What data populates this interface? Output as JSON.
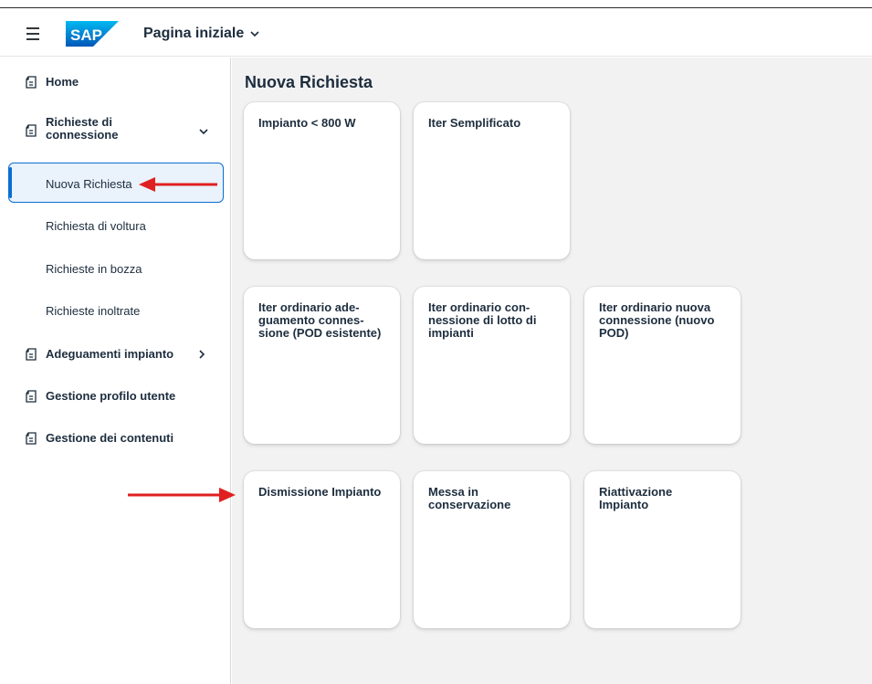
{
  "shell": {
    "logo_text": "SAP",
    "title": "Pagina iniziale"
  },
  "sidebar": {
    "items": [
      {
        "label": "Home"
      },
      {
        "label": "Richieste di connessione",
        "label_line1": "Richieste di",
        "label_line2": "connessione"
      },
      {
        "label": "Nuova Richiesta"
      },
      {
        "label": "Richiesta di voltura"
      },
      {
        "label": "Richieste in bozza"
      },
      {
        "label": "Richieste inoltrate"
      },
      {
        "label": "Adeguamenti impianto"
      },
      {
        "label": "Gestione profilo utente"
      },
      {
        "label": "Gestione dei contenuti"
      }
    ]
  },
  "main": {
    "section_title": "Nuova Richiesta",
    "tiles": [
      {
        "title": "Impianto < 800 W"
      },
      {
        "title": "Iter Semplificato"
      },
      {
        "title": "Iter ordinario adeguamento connessione (POD esistente)",
        "l1": "Iter ordinario ade-",
        "l2": "guamento connes-",
        "l3": "sione (POD esistente)"
      },
      {
        "title": "Iter ordinario connessione di lotto di impianti",
        "l1": "Iter ordinario con-",
        "l2": "nessione di lotto di",
        "l3": "impianti"
      },
      {
        "title": "Iter ordinario nuova connessione (nuovo POD)",
        "l1": "Iter ordinario nuova",
        "l2": "connessione (nuovo",
        "l3": "POD)"
      },
      {
        "title": "Dismissione Impianto"
      },
      {
        "title": "Messa in conservazione",
        "l1": "Messa in",
        "l2": "conservazione"
      },
      {
        "title": "Riattivazione Impianto",
        "l1": "Riattivazione",
        "l2": "Impianto"
      }
    ]
  },
  "colors": {
    "accent": "#0a6ed1",
    "annotation_arrow": "#e02020",
    "content_bg": "#f2f2f2"
  }
}
